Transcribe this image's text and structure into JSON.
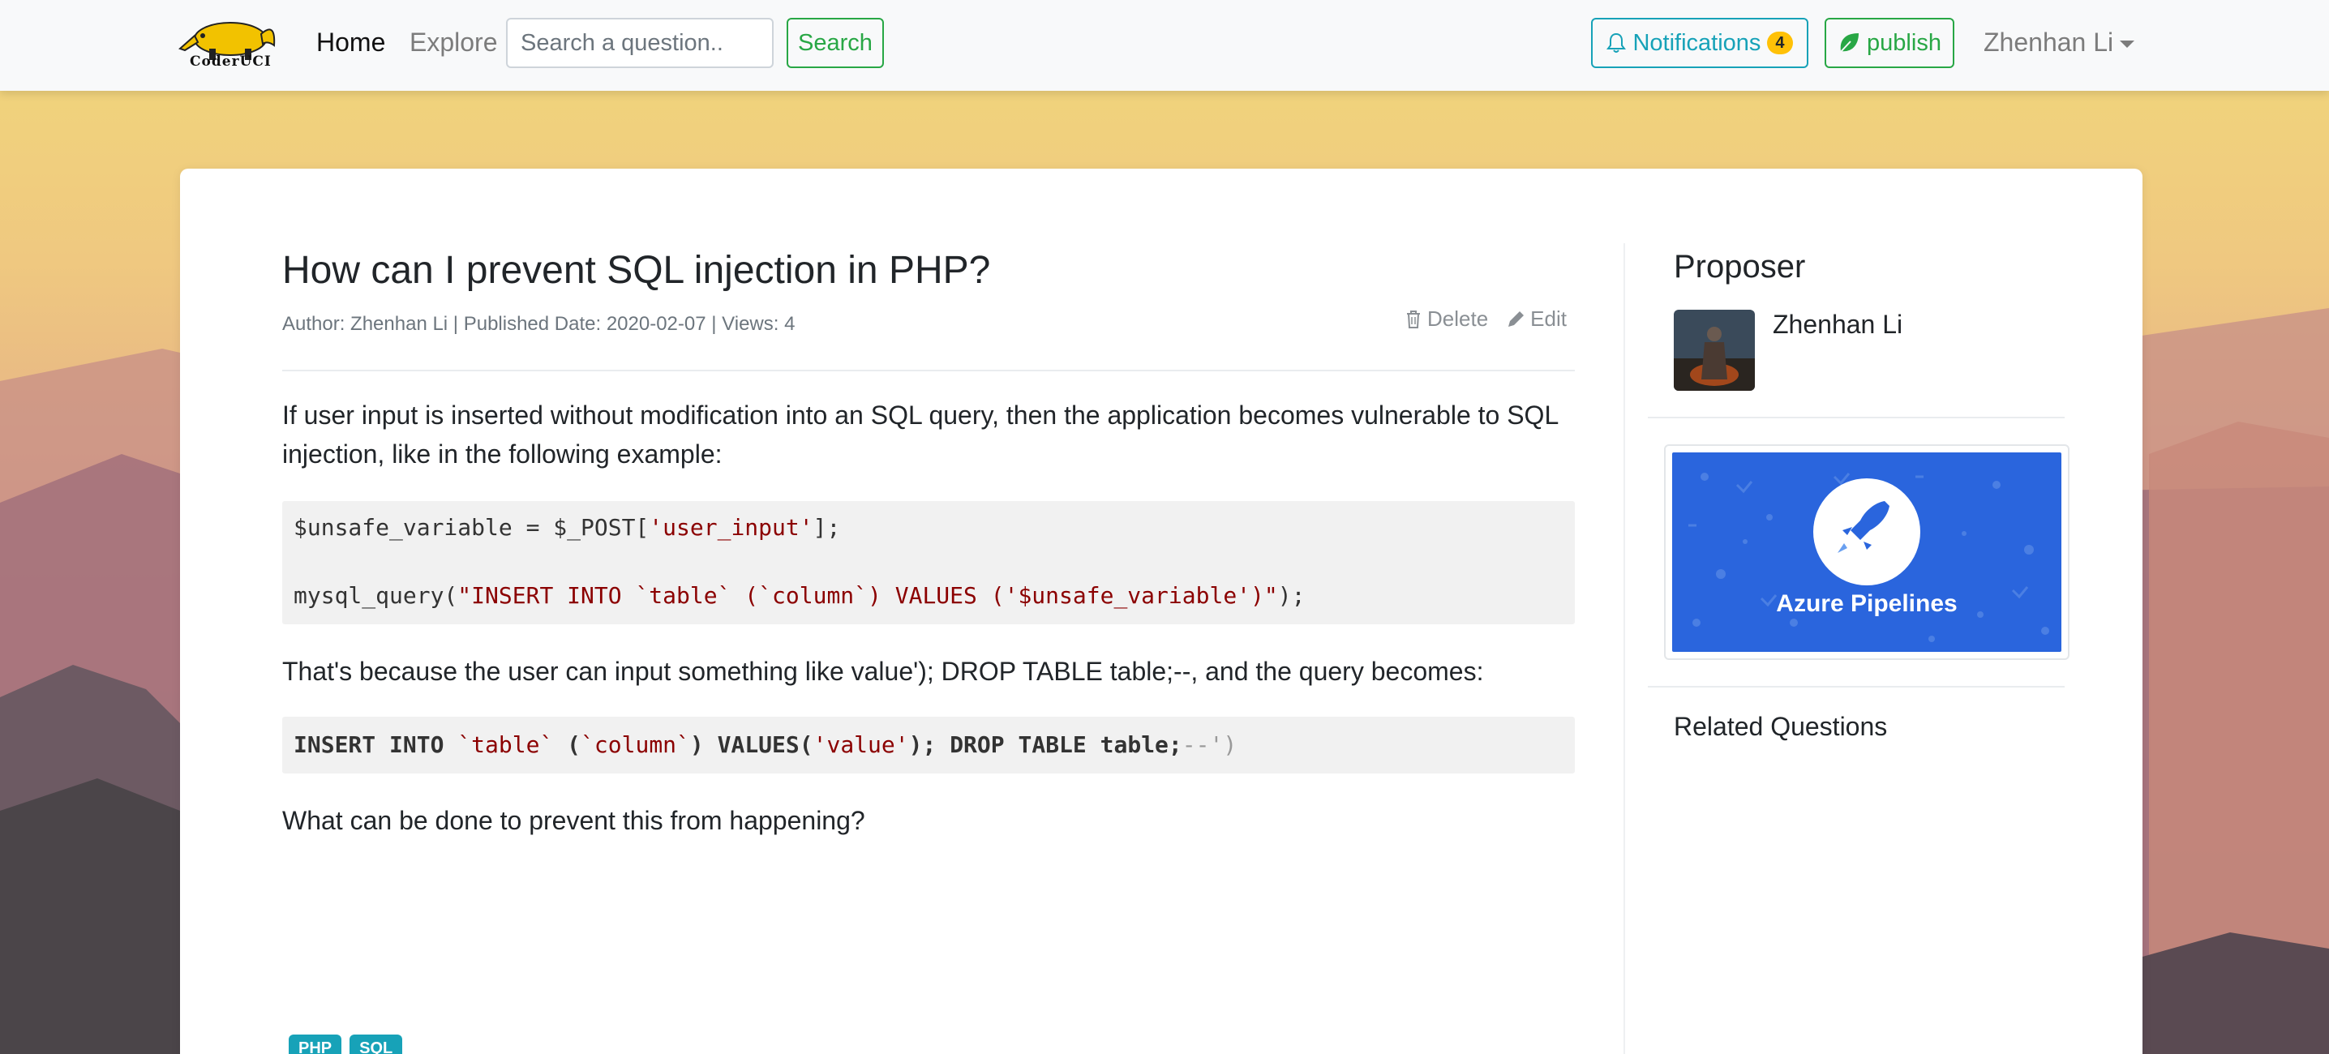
{
  "nav": {
    "logo_text": "CoderUCI",
    "home": "Home",
    "explore": "Explore",
    "search_placeholder": "Search a question..",
    "search_button": "Search",
    "notifications_label": "Notifications",
    "notifications_count": "4",
    "publish_label": "publish",
    "user_name": "Zhenhan Li"
  },
  "question": {
    "title": "How can I prevent SQL injection in PHP?",
    "meta": "Author: Zhenhan Li | Published Date: 2020-02-07 | Views: 4",
    "delete_label": "Delete",
    "edit_label": "Edit",
    "para1": "If user input is inserted without modification into an SQL query, then the application becomes vulnerable to SQL injection, like in the following example:",
    "code1_line1_a": "$unsafe_variable = $_POST[",
    "code1_line1_str": "'user_input'",
    "code1_line1_b": "];",
    "code1_line2_a": "mysql_query(",
    "code1_line2_str": "\"INSERT INTO `table` (`column`) VALUES ('$unsafe_variable')\"",
    "code1_line2_b": ");",
    "para2": "That's because the user can input something like value'); DROP TABLE table;--, and the query becomes:",
    "code2_a": "INSERT INTO ",
    "code2_s1": "`table`",
    "code2_b": " (",
    "code2_s2": "`column`",
    "code2_c": ") VALUES(",
    "code2_s3": "'value'",
    "code2_d": "); DROP TABLE table;",
    "code2_cmt": "--')",
    "para3": "What can be done to prevent this from happening?",
    "tags": [
      "PHP",
      "SQL"
    ]
  },
  "sidebar": {
    "proposer_heading": "Proposer",
    "proposer_name": "Zhenhan Li",
    "ad_label": "Azure Pipelines",
    "related_heading": "Related Questions"
  },
  "colors": {
    "accent_green": "#28a745",
    "accent_teal": "#17a2b8",
    "badge_yellow": "#ffc107",
    "ad_blue": "#2a65dd"
  }
}
